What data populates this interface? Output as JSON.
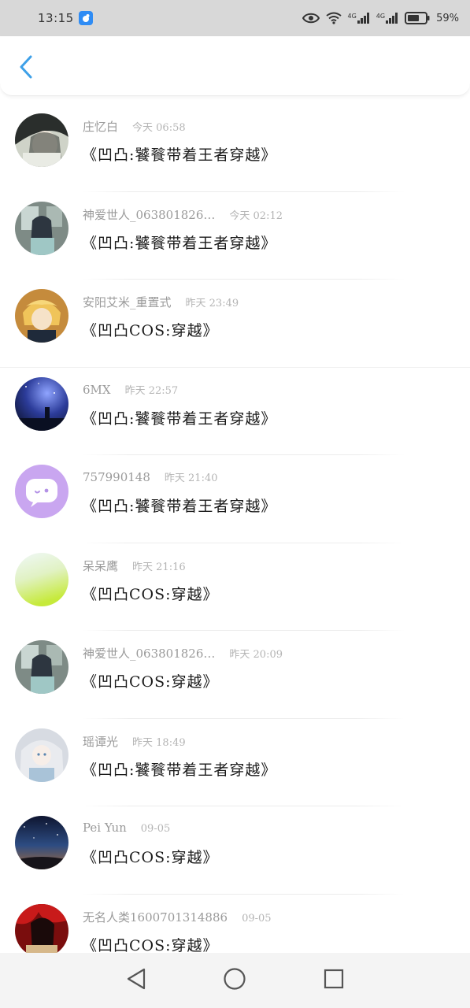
{
  "status_bar": {
    "time": "13:15",
    "battery": "59%",
    "network_1": "4G",
    "network_2": "4G"
  },
  "header": {
    "back_icon": "chevron-left-icon",
    "accent": "#3ea0e8"
  },
  "list": [
    {
      "name": "庄忆白",
      "time": "今天 06:58",
      "message": "《凹凸:饕餮带着王者穿越》",
      "avatar": "anime-portrait-dark"
    },
    {
      "name": "神爱世人_063801826…",
      "time": "今天 02:12",
      "message": "《凹凸:饕餮带着王者穿越》",
      "avatar": "anime-girl-window"
    },
    {
      "name": "安阳艾米_重置式",
      "time": "昨天 23:49",
      "message": "《凹凸COS:穿越》",
      "avatar": "anime-blonde-boy"
    },
    {
      "name": "6MX",
      "time": "昨天 22:57",
      "message": "《凹凸:饕餮带着王者穿越》",
      "avatar": "night-sky-figure"
    },
    {
      "name": "757990148",
      "time": "昨天 21:40",
      "message": "《凹凸:饕餮带着王者穿越》",
      "avatar": "purple-chat-bubble"
    },
    {
      "name": "呆呆鹰",
      "time": "昨天 21:16",
      "message": "《凹凸COS:穿越》",
      "avatar": "green-gradient"
    },
    {
      "name": "神爱世人_063801826…",
      "time": "昨天 20:09",
      "message": "《凹凸COS:穿越》",
      "avatar": "anime-girl-window"
    },
    {
      "name": "瑶谭光",
      "time": "昨天 18:49",
      "message": "《凹凸:饕餮带着王者穿越》",
      "avatar": "anime-silver-hair"
    },
    {
      "name": "Pei Yun",
      "time": "09-05",
      "message": "《凹凸COS:穿越》",
      "avatar": "starry-night-sky"
    },
    {
      "name": "无名人类1600701314886",
      "time": "09-05",
      "message": "《凹凸COS:穿越》",
      "avatar": "anime-red-dark"
    }
  ]
}
